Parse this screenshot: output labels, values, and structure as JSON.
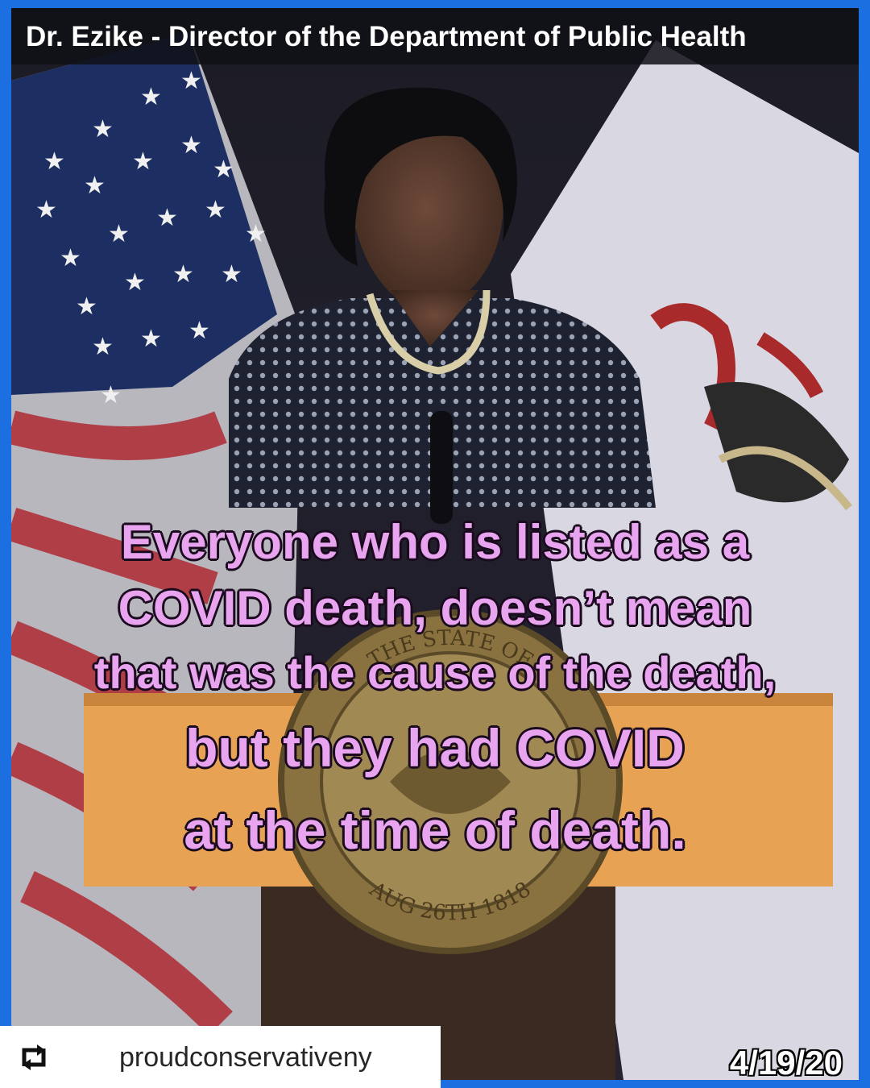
{
  "header": {
    "title": "Dr. Ezike - Director of the Department of Public Health"
  },
  "captions": {
    "line1": "Everyone who is listed as a",
    "line2": "COVID death, doesn’t mean",
    "line3": "that was the cause of the death,",
    "line4": "but they had COVID",
    "line5": "at the time of death."
  },
  "seal": {
    "top_text": "THE STATE OF",
    "bottom_text": "AUG 26TH 1818"
  },
  "date": "4/19/20",
  "repost": {
    "icon": "repost-icon",
    "username": "proudconservativeny"
  },
  "colors": {
    "frame": "#1b6fe0",
    "caption": "#e8a4ee",
    "podium": "#e8a253"
  }
}
